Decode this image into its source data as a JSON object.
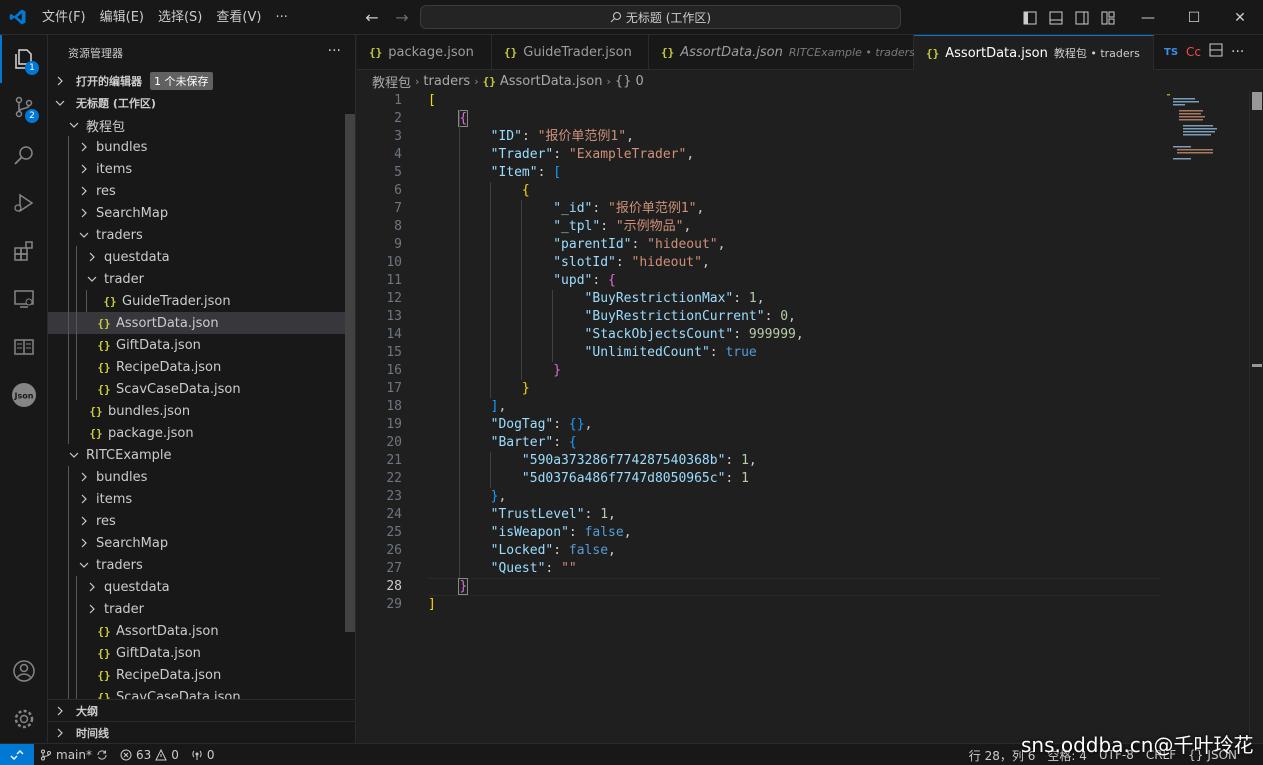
{
  "titlebar": {
    "menu": [
      "文件(F)",
      "编辑(E)",
      "选择(S)",
      "查看(V)"
    ],
    "more": "···",
    "command_center": "无标题 (工作区)"
  },
  "activity_badges": {
    "explorer": "1",
    "scm": "2"
  },
  "sidebar": {
    "title": "资源管理器",
    "more": "···",
    "open_editors_label": "打开的编辑器",
    "unsaved_badge": "1 个未保存",
    "workspace_label": "无标题 (工作区)",
    "tree": [
      {
        "label": "教程包",
        "kind": "folder-open",
        "depth": 1
      },
      {
        "label": "bundles",
        "kind": "folder",
        "depth": 2
      },
      {
        "label": "items",
        "kind": "folder",
        "depth": 2
      },
      {
        "label": "res",
        "kind": "folder",
        "depth": 2
      },
      {
        "label": "SearchMap",
        "kind": "folder",
        "depth": 2
      },
      {
        "label": "traders",
        "kind": "folder-open",
        "depth": 2
      },
      {
        "label": "questdata",
        "kind": "folder",
        "depth": 3
      },
      {
        "label": "trader",
        "kind": "folder-open",
        "depth": 3
      },
      {
        "label": "GuideTrader.json",
        "kind": "json",
        "depth": 4
      },
      {
        "label": "AssortData.json",
        "kind": "json",
        "depth": 3,
        "selected": true
      },
      {
        "label": "GiftData.json",
        "kind": "json",
        "depth": 3
      },
      {
        "label": "RecipeData.json",
        "kind": "json",
        "depth": 3
      },
      {
        "label": "ScavCaseData.json",
        "kind": "json",
        "depth": 3
      },
      {
        "label": "bundles.json",
        "kind": "json",
        "depth": 2
      },
      {
        "label": "package.json",
        "kind": "json",
        "depth": 2
      },
      {
        "label": "RITCExample",
        "kind": "folder-open",
        "depth": 1
      },
      {
        "label": "bundles",
        "kind": "folder",
        "depth": 2
      },
      {
        "label": "items",
        "kind": "folder",
        "depth": 2
      },
      {
        "label": "res",
        "kind": "folder",
        "depth": 2
      },
      {
        "label": "SearchMap",
        "kind": "folder",
        "depth": 2
      },
      {
        "label": "traders",
        "kind": "folder-open",
        "depth": 2
      },
      {
        "label": "questdata",
        "kind": "folder",
        "depth": 3
      },
      {
        "label": "trader",
        "kind": "folder",
        "depth": 3
      },
      {
        "label": "AssortData.json",
        "kind": "json",
        "depth": 3
      },
      {
        "label": "GiftData.json",
        "kind": "json",
        "depth": 3
      },
      {
        "label": "RecipeData.json",
        "kind": "json",
        "depth": 3
      },
      {
        "label": "ScavCaseData.json",
        "kind": "json",
        "depth": 3
      }
    ],
    "outline_label": "大纲",
    "timeline_label": "时间线"
  },
  "tabs": [
    {
      "name": "package.json",
      "desc": "",
      "active": false,
      "italic": false
    },
    {
      "name": "GuideTrader.json",
      "desc": "",
      "active": false,
      "italic": false
    },
    {
      "name": "AssortData.json",
      "desc": "RITCExample • traders",
      "active": false,
      "italic": true
    },
    {
      "name": "AssortData.json",
      "desc": "教程包 • traders",
      "active": true,
      "italic": false,
      "dirty": true
    }
  ],
  "tab_extra": {
    "ts": "TS",
    "cc": "Cc"
  },
  "breadcrumb": [
    "教程包",
    "traders",
    "AssortData.json",
    "{} 0"
  ],
  "editor": {
    "current_line": 28,
    "lines": [
      [
        [
          "y",
          "["
        ]
      ],
      [
        [
          "p",
          "    "
        ],
        [
          "m",
          "{"
        ]
      ],
      [
        [
          "p",
          "        "
        ],
        [
          "k",
          "\"ID\""
        ],
        [
          "p",
          ": "
        ],
        [
          "s",
          "\"报价单范例1\""
        ],
        [
          "p",
          ","
        ]
      ],
      [
        [
          "p",
          "        "
        ],
        [
          "k",
          "\"Trader\""
        ],
        [
          "p",
          ": "
        ],
        [
          "s",
          "\"ExampleTrader\""
        ],
        [
          "p",
          ","
        ]
      ],
      [
        [
          "p",
          "        "
        ],
        [
          "k",
          "\"Item\""
        ],
        [
          "p",
          ": "
        ],
        [
          "bl",
          "["
        ]
      ],
      [
        [
          "p",
          "            "
        ],
        [
          "y",
          "{"
        ]
      ],
      [
        [
          "p",
          "                "
        ],
        [
          "k",
          "\"_id\""
        ],
        [
          "p",
          ": "
        ],
        [
          "s",
          "\"报价单范例1\""
        ],
        [
          "p",
          ","
        ]
      ],
      [
        [
          "p",
          "                "
        ],
        [
          "k",
          "\"_tpl\""
        ],
        [
          "p",
          ": "
        ],
        [
          "s",
          "\"示例物品\""
        ],
        [
          "p",
          ","
        ]
      ],
      [
        [
          "p",
          "                "
        ],
        [
          "k",
          "\"parentId\""
        ],
        [
          "p",
          ": "
        ],
        [
          "s",
          "\"hideout\""
        ],
        [
          "p",
          ","
        ]
      ],
      [
        [
          "p",
          "                "
        ],
        [
          "k",
          "\"slotId\""
        ],
        [
          "p",
          ": "
        ],
        [
          "s",
          "\"hideout\""
        ],
        [
          "p",
          ","
        ]
      ],
      [
        [
          "p",
          "                "
        ],
        [
          "k",
          "\"upd\""
        ],
        [
          "p",
          ": "
        ],
        [
          "m",
          "{"
        ]
      ],
      [
        [
          "p",
          "                    "
        ],
        [
          "k",
          "\"BuyRestrictionMax\""
        ],
        [
          "p",
          ": "
        ],
        [
          "n",
          "1"
        ],
        [
          "p",
          ","
        ]
      ],
      [
        [
          "p",
          "                    "
        ],
        [
          "k",
          "\"BuyRestrictionCurrent\""
        ],
        [
          "p",
          ": "
        ],
        [
          "n",
          "0"
        ],
        [
          "p",
          ","
        ]
      ],
      [
        [
          "p",
          "                    "
        ],
        [
          "k",
          "\"StackObjectsCount\""
        ],
        [
          "p",
          ": "
        ],
        [
          "n",
          "999999"
        ],
        [
          "p",
          ","
        ]
      ],
      [
        [
          "p",
          "                    "
        ],
        [
          "k",
          "\"UnlimitedCount\""
        ],
        [
          "p",
          ": "
        ],
        [
          "b",
          "true"
        ]
      ],
      [
        [
          "p",
          "                "
        ],
        [
          "m",
          "}"
        ]
      ],
      [
        [
          "p",
          "            "
        ],
        [
          "y",
          "}"
        ]
      ],
      [
        [
          "p",
          "        "
        ],
        [
          "bl",
          "]"
        ],
        [
          "p",
          ","
        ]
      ],
      [
        [
          "p",
          "        "
        ],
        [
          "k",
          "\"DogTag\""
        ],
        [
          "p",
          ": "
        ],
        [
          "bl",
          "{}"
        ],
        [
          "p",
          ","
        ]
      ],
      [
        [
          "p",
          "        "
        ],
        [
          "k",
          "\"Barter\""
        ],
        [
          "p",
          ": "
        ],
        [
          "bl",
          "{"
        ]
      ],
      [
        [
          "p",
          "            "
        ],
        [
          "k",
          "\"590a373286f774287540368b\""
        ],
        [
          "p",
          ": "
        ],
        [
          "n",
          "1"
        ],
        [
          "p",
          ","
        ]
      ],
      [
        [
          "p",
          "            "
        ],
        [
          "k",
          "\"5d0376a486f7747d8050965c\""
        ],
        [
          "p",
          ": "
        ],
        [
          "n",
          "1"
        ]
      ],
      [
        [
          "p",
          "        "
        ],
        [
          "bl",
          "}"
        ],
        [
          "p",
          ","
        ]
      ],
      [
        [
          "p",
          "        "
        ],
        [
          "k",
          "\"TrustLevel\""
        ],
        [
          "p",
          ": "
        ],
        [
          "n",
          "1"
        ],
        [
          "p",
          ","
        ]
      ],
      [
        [
          "p",
          "        "
        ],
        [
          "k",
          "\"isWeapon\""
        ],
        [
          "p",
          ": "
        ],
        [
          "b",
          "false"
        ],
        [
          "p",
          ","
        ]
      ],
      [
        [
          "p",
          "        "
        ],
        [
          "k",
          "\"Locked\""
        ],
        [
          "p",
          ": "
        ],
        [
          "b",
          "false"
        ],
        [
          "p",
          ","
        ]
      ],
      [
        [
          "p",
          "        "
        ],
        [
          "k",
          "\"Quest\""
        ],
        [
          "p",
          ": "
        ],
        [
          "s",
          "\"\""
        ]
      ],
      [
        [
          "p",
          "    "
        ],
        [
          "m",
          "}"
        ]
      ],
      [
        [
          "y",
          "]"
        ]
      ]
    ]
  },
  "statusbar": {
    "branch": "main*",
    "errors": "63",
    "warnings": "0",
    "ports": "0",
    "position": "行 28，列 6",
    "spaces": "空格: 4",
    "encoding": "UTF-8",
    "eol": "CRLF",
    "language": "JSON"
  },
  "watermark": "sns.oddba.cn@千叶玲花",
  "colors": {
    "accent": "#0078d4",
    "json_icon": "#cbcb41",
    "key": "#9cdcfe",
    "string": "#ce9178",
    "number": "#b5cea8",
    "keyword": "#569cd6"
  }
}
